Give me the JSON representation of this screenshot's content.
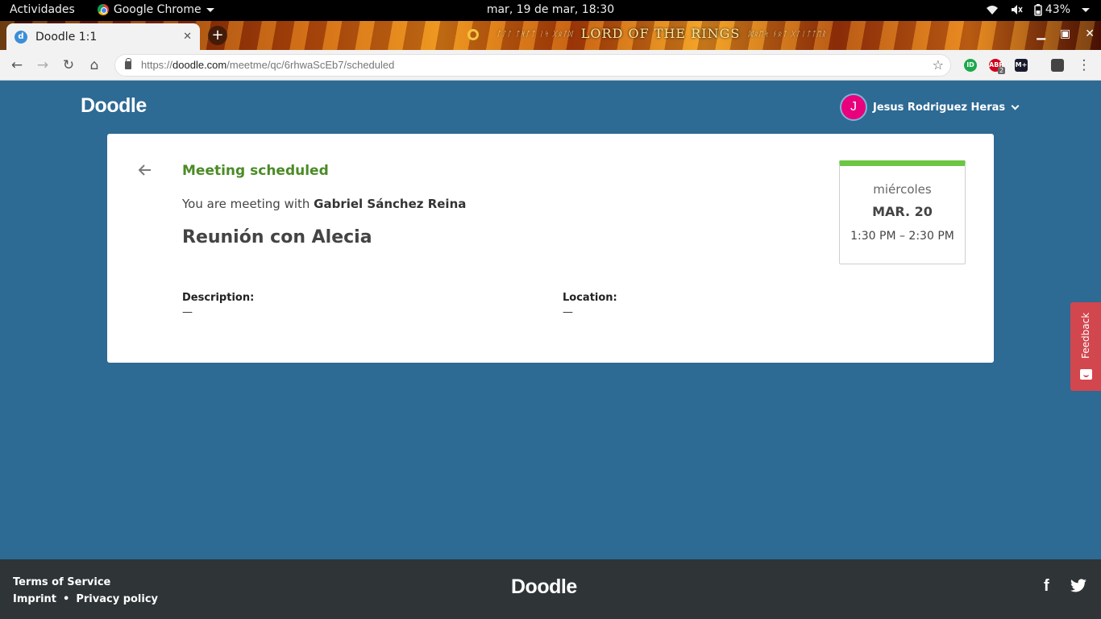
{
  "system_bar": {
    "activities": "Actividades",
    "app_name": "Google Chrome",
    "clock": "mar, 19 de mar, 18:30",
    "battery": "43%"
  },
  "browser": {
    "tab_title": "Doodle 1:1",
    "tab_favicon": "d",
    "theme_banner": "LORD OF THE RINGS",
    "url_scheme": "https://",
    "url_host": "doodle.com",
    "url_path": "/meetme/qc/6rhwaScEb7/scheduled",
    "extension_badge": "2",
    "ext_abp": "ABP",
    "ext_m": "M+"
  },
  "header": {
    "brand": "Doodle",
    "user_initial": "J",
    "user_name": "Jesus Rodriguez Heras"
  },
  "meeting": {
    "status": "Meeting scheduled",
    "with_prefix": "You are meeting with ",
    "with_name": "Gabriel Sánchez Reina",
    "title": "Reunión con Alecia",
    "description_label": "Description:",
    "description_value": "—",
    "location_label": "Location:",
    "location_value": "—",
    "weekday": "miércoles",
    "date": "MAR. 20",
    "time_range": "1:30 PM – 2:30 PM"
  },
  "feedback": {
    "label": "Feedback"
  },
  "footer": {
    "terms": "Terms of Service",
    "imprint": "Imprint",
    "separator": "•",
    "privacy": "Privacy policy",
    "brand": "Doodle",
    "facebook": "f"
  },
  "colors": {
    "page_bg": "#2d6a94",
    "accent_green": "#4b8b27",
    "date_bar": "#6cc644",
    "avatar": "#e8007d",
    "feedback": "#d2464e",
    "footer_bg": "#2f3437"
  }
}
